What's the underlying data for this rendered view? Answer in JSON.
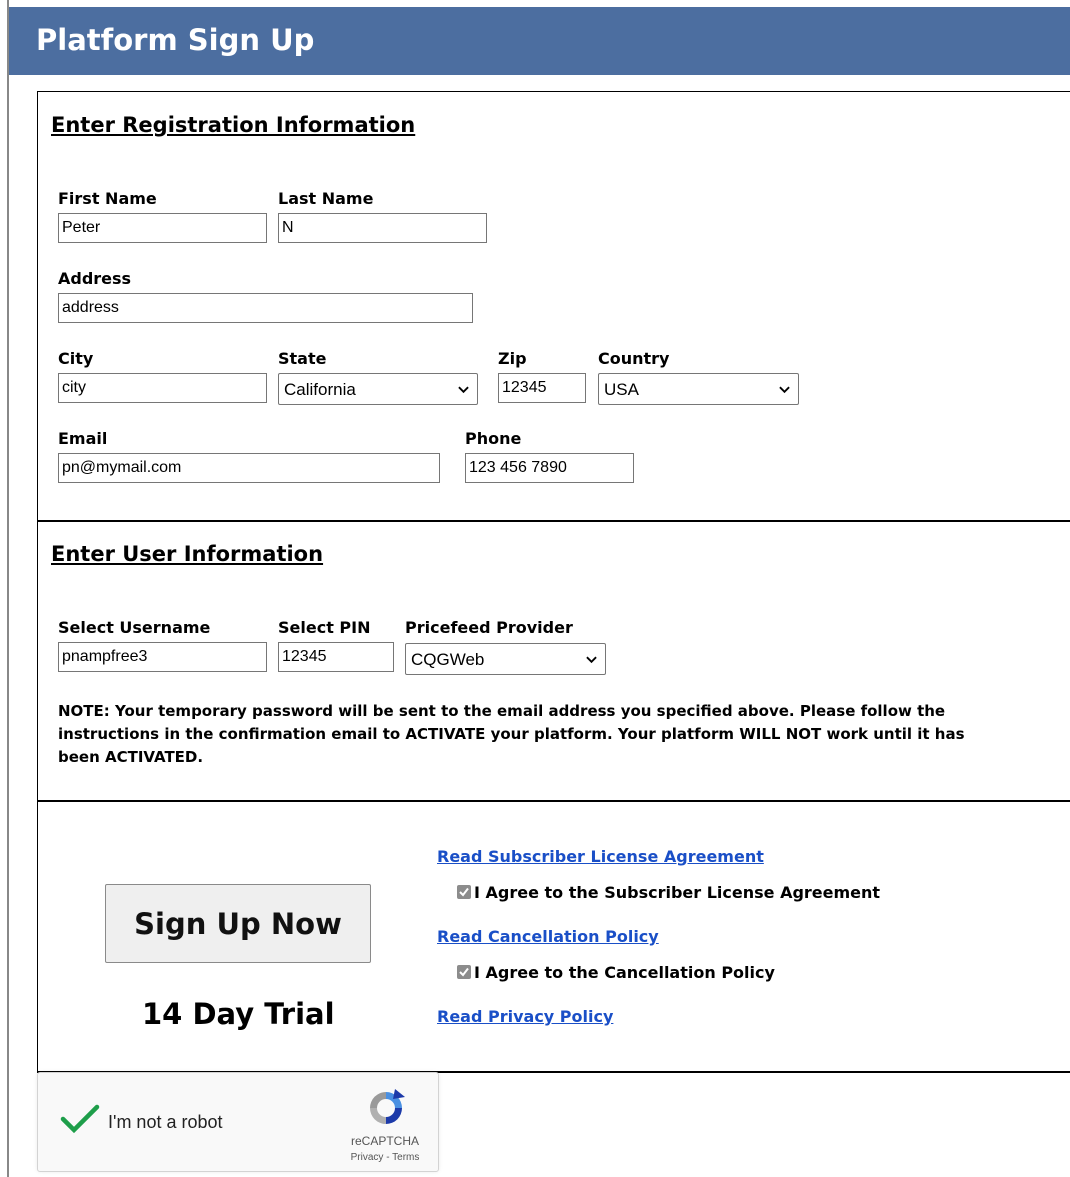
{
  "header": {
    "title": "Platform Sign Up"
  },
  "registration": {
    "title": "Enter Registration Information",
    "first_name": {
      "label": "First Name",
      "value": "Peter"
    },
    "last_name": {
      "label": "Last Name",
      "value": "N"
    },
    "address": {
      "label": "Address",
      "value": "address"
    },
    "city": {
      "label": "City",
      "value": "city"
    },
    "state": {
      "label": "State",
      "value": "California"
    },
    "zip": {
      "label": "Zip",
      "value": "12345"
    },
    "country": {
      "label": "Country",
      "value": "USA"
    },
    "email": {
      "label": "Email",
      "value": "pn@mymail.com"
    },
    "phone": {
      "label": "Phone",
      "value": "123 456 7890"
    }
  },
  "user": {
    "title": "Enter User Information",
    "username": {
      "label": "Select Username",
      "value": "pnampfree3"
    },
    "pin": {
      "label": "Select PIN",
      "value": "12345"
    },
    "pricefeed": {
      "label": "Pricefeed Provider",
      "value": "CQGWeb"
    },
    "note": "NOTE: Your temporary password will be sent to the email address you specified above. Please follow the instructions in the confirmation email to ACTIVATE your platform. Your platform WILL NOT work until it has been ACTIVATED."
  },
  "signup": {
    "button_label": "Sign Up Now",
    "trial_text": "14 Day Trial",
    "license_link": "Read Subscriber License Agreement",
    "license_agree": "I Agree to the Subscriber License Agreement",
    "license_checked": true,
    "cancellation_link": "Read Cancellation Policy",
    "cancellation_agree": "I Agree to the Cancellation Policy",
    "cancellation_checked": true,
    "privacy_link": "Read Privacy Policy"
  },
  "recaptcha": {
    "label": "I'm not a robot",
    "brand": "reCAPTCHA",
    "links": "Privacy - Terms",
    "checked": true
  },
  "colors": {
    "header_bg": "#4c6ea0",
    "link": "#1a4fc7",
    "check_green": "#1e9e4a"
  }
}
